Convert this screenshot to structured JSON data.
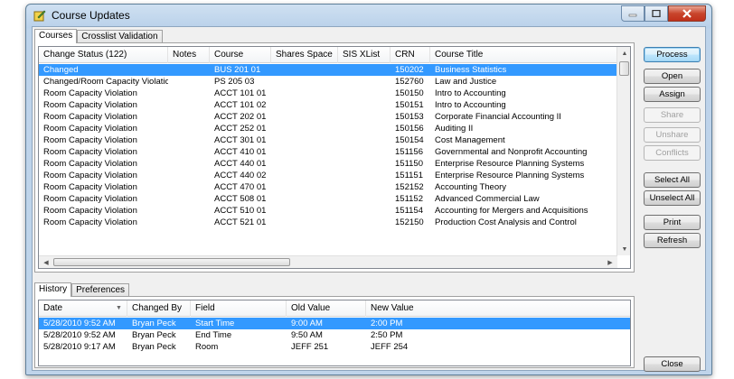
{
  "window": {
    "title": "Course Updates",
    "app_icon": "edit-pencil-icon"
  },
  "top_tabs": [
    {
      "label": "Courses",
      "active": true
    },
    {
      "label": "Crosslist Validation",
      "active": false
    }
  ],
  "courses_grid": {
    "columns": [
      "Change Status (122)",
      "Notes",
      "Course",
      "Shares Space",
      "SIS XList",
      "CRN",
      "Course Title"
    ],
    "rows": [
      {
        "status": "Changed",
        "notes": "",
        "course": "BUS 201 01",
        "shares": "",
        "xlist": "",
        "crn": "150202",
        "title": "Business Statistics",
        "selected": true
      },
      {
        "status": "Changed/Room Capacity Violation",
        "notes": "",
        "course": "PS 205 03",
        "shares": "",
        "xlist": "",
        "crn": "152760",
        "title": "Law and Justice"
      },
      {
        "status": "Room Capacity Violation",
        "notes": "",
        "course": "ACCT 101 01",
        "shares": "",
        "xlist": "",
        "crn": "150150",
        "title": "Intro to Accounting"
      },
      {
        "status": "Room Capacity Violation",
        "notes": "",
        "course": "ACCT 101 02",
        "shares": "",
        "xlist": "",
        "crn": "150151",
        "title": "Intro to Accounting"
      },
      {
        "status": "Room Capacity Violation",
        "notes": "",
        "course": "ACCT 202 01",
        "shares": "",
        "xlist": "",
        "crn": "150153",
        "title": "Corporate Financial Accounting II"
      },
      {
        "status": "Room Capacity Violation",
        "notes": "",
        "course": "ACCT 252 01",
        "shares": "",
        "xlist": "",
        "crn": "150156",
        "title": "Auditing II"
      },
      {
        "status": "Room Capacity Violation",
        "notes": "",
        "course": "ACCT 301 01",
        "shares": "",
        "xlist": "",
        "crn": "150154",
        "title": "Cost Management"
      },
      {
        "status": "Room Capacity Violation",
        "notes": "",
        "course": "ACCT 410 01",
        "shares": "",
        "xlist": "",
        "crn": "151156",
        "title": "Governmental and Nonprofit Accounting"
      },
      {
        "status": "Room Capacity Violation",
        "notes": "",
        "course": "ACCT 440 01",
        "shares": "",
        "xlist": "",
        "crn": "151150",
        "title": "Enterprise Resource Planning Systems"
      },
      {
        "status": "Room Capacity Violation",
        "notes": "",
        "course": "ACCT 440 02",
        "shares": "",
        "xlist": "",
        "crn": "151151",
        "title": "Enterprise Resource Planning Systems"
      },
      {
        "status": "Room Capacity Violation",
        "notes": "",
        "course": "ACCT 470 01",
        "shares": "",
        "xlist": "",
        "crn": "152152",
        "title": "Accounting Theory"
      },
      {
        "status": "Room Capacity Violation",
        "notes": "",
        "course": "ACCT 508 01",
        "shares": "",
        "xlist": "",
        "crn": "151152",
        "title": "Advanced Commercial Law"
      },
      {
        "status": "Room Capacity Violation",
        "notes": "",
        "course": "ACCT 510 01",
        "shares": "",
        "xlist": "",
        "crn": "151154",
        "title": "Accounting for Mergers and Acquisitions"
      },
      {
        "status": "Room Capacity Violation",
        "notes": "",
        "course": "ACCT 521 01",
        "shares": "",
        "xlist": "",
        "crn": "152150",
        "title": "Production Cost Analysis and Control"
      }
    ]
  },
  "buttons": {
    "process": "Process",
    "open": "Open",
    "assign": "Assign",
    "share": "Share",
    "unshare": "Unshare",
    "conflicts": "Conflicts",
    "select_all": "Select All",
    "unselect_all": "Unselect All",
    "print": "Print",
    "refresh": "Refresh",
    "close": "Close"
  },
  "bottom_tabs": [
    {
      "label": "History",
      "active": true
    },
    {
      "label": "Preferences",
      "active": false
    }
  ],
  "history_grid": {
    "columns": [
      "Date",
      "Changed By",
      "Field",
      "Old Value",
      "New Value"
    ],
    "rows": [
      {
        "date": "5/28/2010 9:52 AM",
        "by": "Bryan Peck",
        "field": "Start Time",
        "old": "9:00 AM",
        "new": "2:00 PM",
        "selected": true
      },
      {
        "date": "5/28/2010 9:52 AM",
        "by": "Bryan Peck",
        "field": "End Time",
        "old": "9:50 AM",
        "new": "2:50 PM"
      },
      {
        "date": "5/28/2010 9:17 AM",
        "by": "Bryan Peck",
        "field": "Room",
        "old": "JEFF 251",
        "new": "JEFF 254"
      }
    ]
  },
  "colors": {
    "selection": "#3399ff",
    "title_bar": "#bcd3ea",
    "close_button": "#c9452c"
  }
}
